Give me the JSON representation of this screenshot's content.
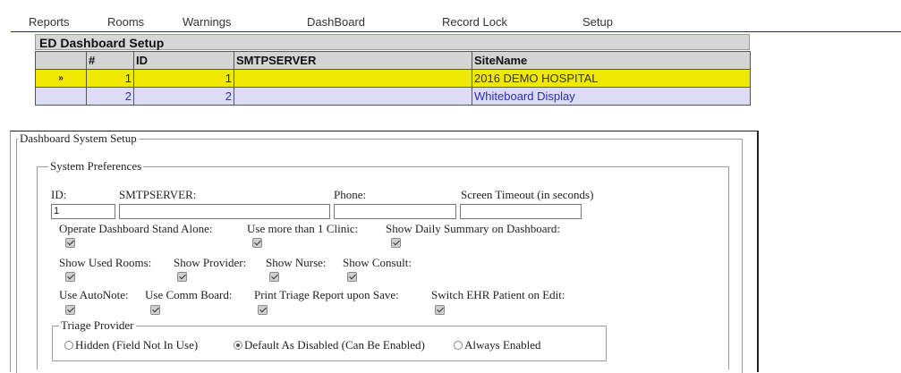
{
  "menu": [
    "Reports",
    "Rooms",
    "Warnings",
    "DashBoard",
    "Record Lock",
    "Setup"
  ],
  "grid": {
    "title": "ED Dashboard Setup",
    "columns": [
      "",
      "#",
      "ID",
      "SMTPSERVER",
      "SiteName"
    ],
    "rows": [
      {
        "indicator": "»",
        "num": "1",
        "id": "1",
        "smtp": "",
        "site": "2016 DEMO HOSPITAL",
        "selected": true
      },
      {
        "indicator": "",
        "num": "2",
        "id": "2",
        "smtp": "",
        "site": "Whiteboard Display",
        "selected": false
      }
    ]
  },
  "setup": {
    "legend": "Dashboard System Setup",
    "prefs_legend": "System Preferences",
    "fields": {
      "id_label": "ID:",
      "id_value": "1",
      "smtp_label": "SMTPSERVER:",
      "smtp_value": "",
      "phone_label": "Phone:",
      "phone_value": "",
      "timeout_label": "Screen Timeout (in seconds)",
      "timeout_value": ""
    },
    "checks_row1": [
      {
        "label": "Operate Dashboard Stand Alone:",
        "checked": true
      },
      {
        "label": "Use more than 1 Clinic:",
        "checked": true
      },
      {
        "label": "Show Daily Summary on Dashboard:",
        "checked": true
      }
    ],
    "checks_row2": [
      {
        "label": "Show Used Rooms:",
        "checked": true
      },
      {
        "label": "Show Provider:",
        "checked": true
      },
      {
        "label": "Show Nurse:",
        "checked": true
      },
      {
        "label": "Show Consult:",
        "checked": true
      }
    ],
    "checks_row3": [
      {
        "label": "Use AutoNote:",
        "checked": true
      },
      {
        "label": "Use Comm Board:",
        "checked": true
      },
      {
        "label": "Print Triage Report upon Save:",
        "checked": true
      },
      {
        "label": "Switch EHR Patient on Edit:",
        "checked": true
      }
    ],
    "triage": {
      "legend": "Triage Provider",
      "options": [
        {
          "label": "Hidden (Field Not In Use)",
          "selected": false
        },
        {
          "label": "Default As Disabled (Can Be Enabled)",
          "selected": true
        },
        {
          "label": "Always Enabled",
          "selected": false
        }
      ]
    }
  }
}
